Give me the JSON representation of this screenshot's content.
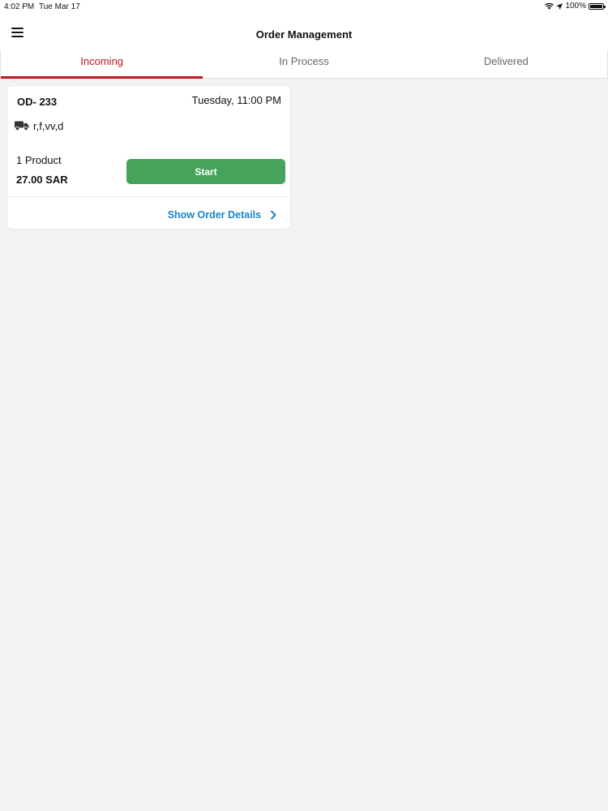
{
  "status_bar": {
    "time": "4:02 PM",
    "date": "Tue Mar 17",
    "battery": "100%",
    "icons": [
      "wifi-icon",
      "location-arrow-icon",
      "battery-icon"
    ]
  },
  "header": {
    "title": "Order Management",
    "menu_icon": "hamburger-menu-icon"
  },
  "tabs": [
    {
      "label": "Incoming",
      "active": true
    },
    {
      "label": "In Process",
      "active": false
    },
    {
      "label": "Delivered",
      "active": false
    }
  ],
  "orders": [
    {
      "id": "OD- 233",
      "time": "Tuesday, 11:00 PM",
      "delivery_icon": "truck-icon",
      "address": "r,f,vv,d",
      "product_count": "1 Product",
      "price": "27.00 SAR",
      "start_label": "Start",
      "details_label": "Show Order Details"
    }
  ],
  "colors": {
    "accent": "#c0161d",
    "start_button": "#45a35a",
    "link": "#1a84c9",
    "background": "#f2f2f3"
  }
}
